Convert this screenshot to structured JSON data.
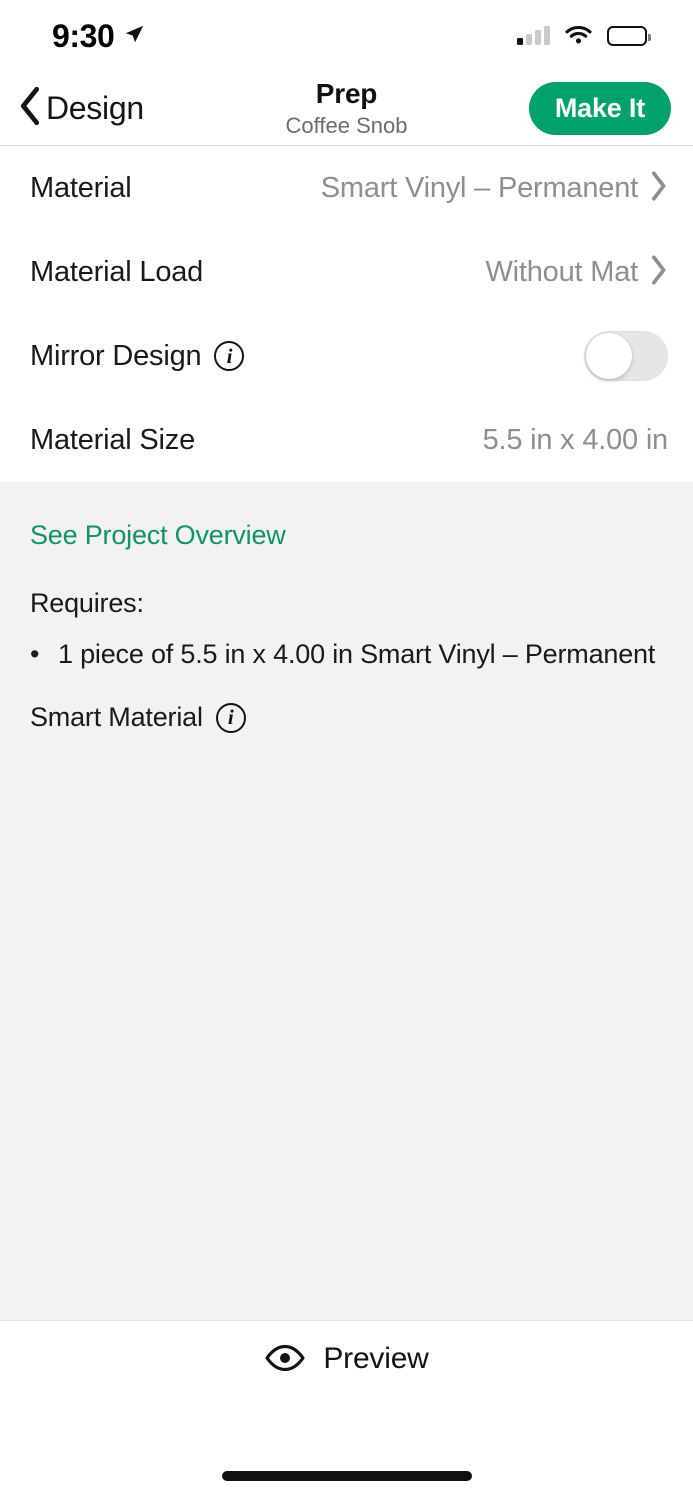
{
  "status_bar": {
    "time": "9:30",
    "location_icon": "location-arrow-icon",
    "signal_icon": "cellular-signal-icon",
    "wifi_icon": "wifi-icon",
    "battery_icon": "battery-icon"
  },
  "nav": {
    "back_label": "Design",
    "back_icon": "chevron-left-icon",
    "title": "Prep",
    "subtitle": "Coffee Snob",
    "primary_action": "Make It",
    "accent_color": "#00a16d"
  },
  "settings": {
    "rows": [
      {
        "label": "Material",
        "value": "Smart Vinyl – Permanent",
        "accessory": "chevron-right-icon"
      },
      {
        "label": "Material Load",
        "value": "Without Mat",
        "accessory": "chevron-right-icon"
      },
      {
        "label": "Mirror Design",
        "info_icon": "info-circle-icon",
        "accessory": "toggle-switch",
        "toggle_state": "off"
      },
      {
        "label": "Material Size",
        "value": "5.5 in x 4.00 in",
        "accessory": "none"
      }
    ]
  },
  "info_panel": {
    "overview_link": "See Project Overview",
    "link_color": "#129267",
    "requires_label": "Requires:",
    "bullet_glyph": "•",
    "requires_items": [
      "1 piece of 5.5 in x 4.00 in Smart Vinyl – Permanent"
    ],
    "smart_material_label": "Smart Material",
    "smart_material_info_icon": "info-circle-icon",
    "background_color": "#f2f2f2"
  },
  "bottom_bar": {
    "preview_label": "Preview",
    "preview_icon": "eye-icon"
  }
}
